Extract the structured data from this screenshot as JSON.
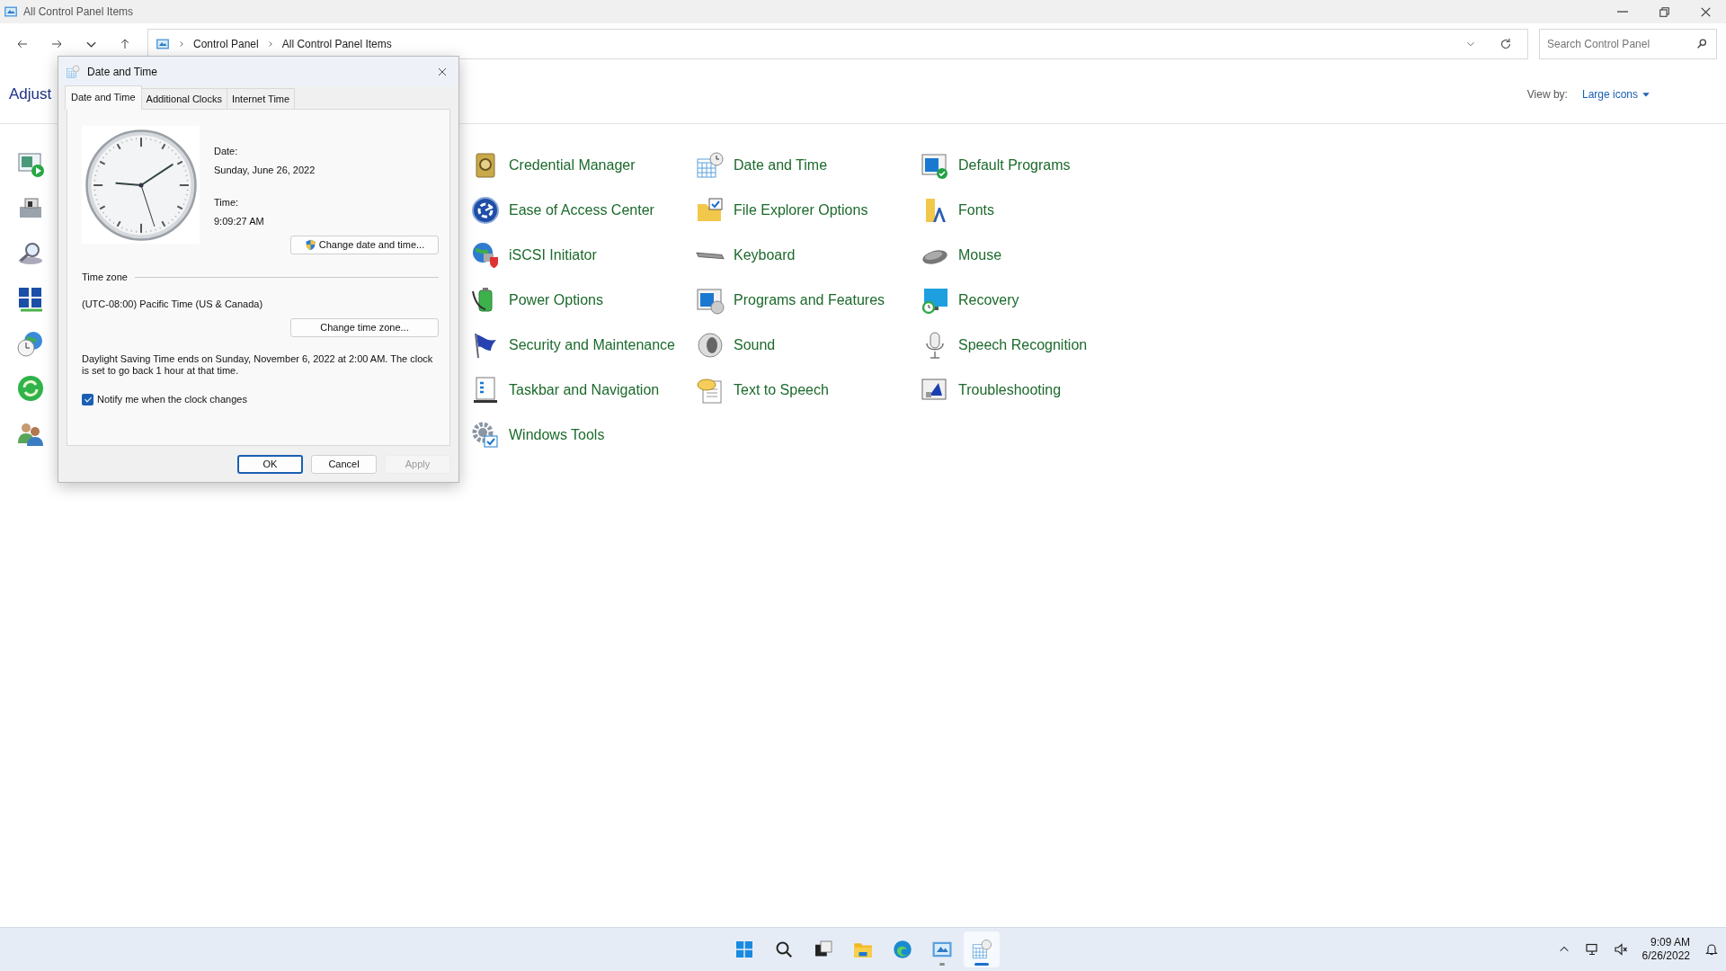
{
  "window": {
    "title": "All Control Panel Items"
  },
  "address": {
    "breadcrumb": [
      "Control Panel",
      "All Control Panel Items"
    ]
  },
  "search": {
    "placeholder": "Search Control Panel"
  },
  "heading": "Adjust",
  "view_by": {
    "label": "View by:",
    "value": "Large icons"
  },
  "items": [
    {
      "label": "Credential Manager"
    },
    {
      "label": "Date and Time"
    },
    {
      "label": "Default Programs"
    },
    {
      "label": "Ease of Access Center"
    },
    {
      "label": "File Explorer Options"
    },
    {
      "label": "Fonts"
    },
    {
      "label": "iSCSI Initiator"
    },
    {
      "label": "Keyboard"
    },
    {
      "label": "Mouse"
    },
    {
      "label": "Power Options"
    },
    {
      "label": "Programs and Features"
    },
    {
      "label": "Recovery"
    },
    {
      "label": "Security and Maintenance"
    },
    {
      "label": "Sound"
    },
    {
      "label": "Speech Recognition"
    },
    {
      "label": "Taskbar and Navigation"
    },
    {
      "label": "Text to Speech"
    },
    {
      "label": "Troubleshooting"
    },
    {
      "label": "Windows Tools"
    }
  ],
  "dialog": {
    "title": "Date and Time",
    "tabs": [
      {
        "label": "Date and Time",
        "selected": true
      },
      {
        "label": "Additional Clocks",
        "selected": false
      },
      {
        "label": "Internet Time",
        "selected": false
      }
    ],
    "date_label": "Date:",
    "date": "Sunday, June 26, 2022",
    "time_label": "Time:",
    "time": "9:09:27 AM",
    "change_datetime_button": "Change date and time...",
    "timezone_label": "Time zone",
    "timezone": "(UTC-08:00) Pacific Time (US & Canada)",
    "change_timezone_button": "Change time zone...",
    "dst_notice": "Daylight Saving Time ends on Sunday, November 6, 2022 at 2:00 AM. The clock is set to go back 1 hour at that time.",
    "notify_checkbox": {
      "label": "Notify me when the clock changes",
      "checked": true
    },
    "buttons": [
      {
        "label": "OK",
        "default": true,
        "disabled": false
      },
      {
        "label": "Cancel",
        "default": false,
        "disabled": false
      },
      {
        "label": "Apply",
        "default": false,
        "disabled": true
      }
    ]
  },
  "taskbar": {
    "apps": [
      {
        "running": false,
        "active": false
      },
      {
        "running": false,
        "active": false
      },
      {
        "running": false,
        "active": false
      },
      {
        "running": false,
        "active": false
      },
      {
        "running": false,
        "active": false
      },
      {
        "running": true,
        "active": false
      },
      {
        "running": true,
        "active": true
      }
    ],
    "time": "9:09 AM",
    "date": "6/26/2022"
  }
}
